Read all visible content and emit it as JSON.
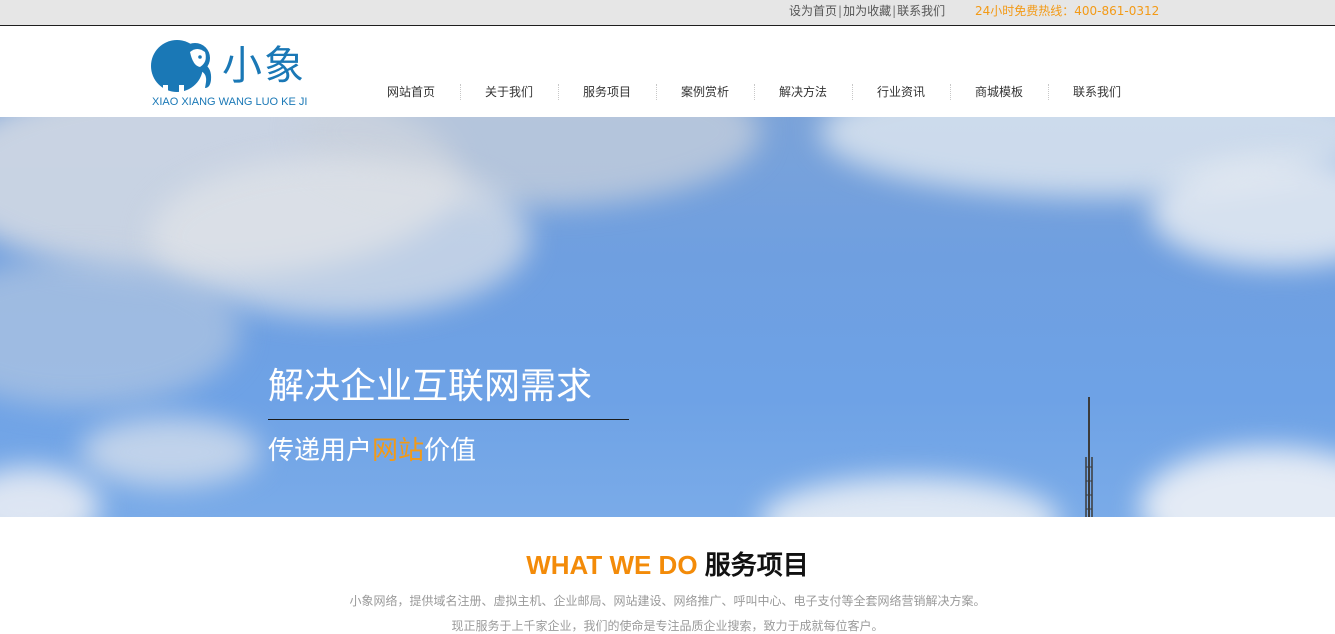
{
  "topbar": {
    "links": [
      "设为首页",
      "加为收藏",
      "联系我们"
    ],
    "separator": "|",
    "hotline": "24小时免费热线：400-861-0312"
  },
  "logo": {
    "name": "小象",
    "subtitle": "XIAO XIANG WANG LUO KE JI",
    "icon": "elephant-icon",
    "color": "#1a78b6"
  },
  "nav": {
    "items": [
      {
        "label": "网站首页"
      },
      {
        "label": "关于我们"
      },
      {
        "label": "服务项目"
      },
      {
        "label": "案例赏析"
      },
      {
        "label": "解决方法"
      },
      {
        "label": "行业资讯"
      },
      {
        "label": "商城模板"
      },
      {
        "label": "联系我们"
      }
    ]
  },
  "hero": {
    "headline": "解决企业互联网需求",
    "subline_pre": "传递用户",
    "subline_accent": "网站",
    "subline_post": "价值",
    "accent_color": "#f39a16"
  },
  "services": {
    "title_en": "WHAT WE DO",
    "title_cn": "服务项目",
    "desc_line1": "小象网络，提供域名注册、虚拟主机、企业邮局、网站建设、网络推广、呼叫中心、电子支付等全套网络营销解决方案。",
    "desc_line2": "现正服务于上千家企业，我们的使命是专注品质企业搜索，致力于成就每位客户。",
    "accent_color": "#f38b09"
  }
}
